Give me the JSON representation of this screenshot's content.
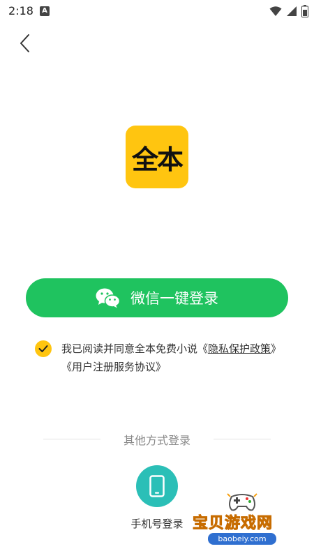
{
  "status_bar": {
    "time": "2:18",
    "notification_icon": "a-letter-icon",
    "icons": [
      "wifi-icon",
      "signal-icon",
      "battery-icon"
    ]
  },
  "nav": {
    "back_icon": "chevron-left-icon"
  },
  "logo": {
    "text": "全本",
    "background": "#ffc510"
  },
  "wechat_login": {
    "label": "微信一键登录",
    "icon": "wechat-icon",
    "color": "#1fc35f"
  },
  "agreement": {
    "checked": true,
    "text_prefix": "我已阅读并同意全本免费小说《",
    "privacy_link": "隐私保护政策",
    "text_middle": "》《",
    "terms_link": "用户注册服务协议",
    "text_suffix": "》"
  },
  "other_methods": {
    "title": "其他方式登录",
    "phone_login_label": "手机号登录",
    "phone_icon": "phone-icon",
    "phone_color": "#2bbfb7"
  },
  "watermark": {
    "title": "宝贝游戏网",
    "url": "baobeiy.com"
  }
}
